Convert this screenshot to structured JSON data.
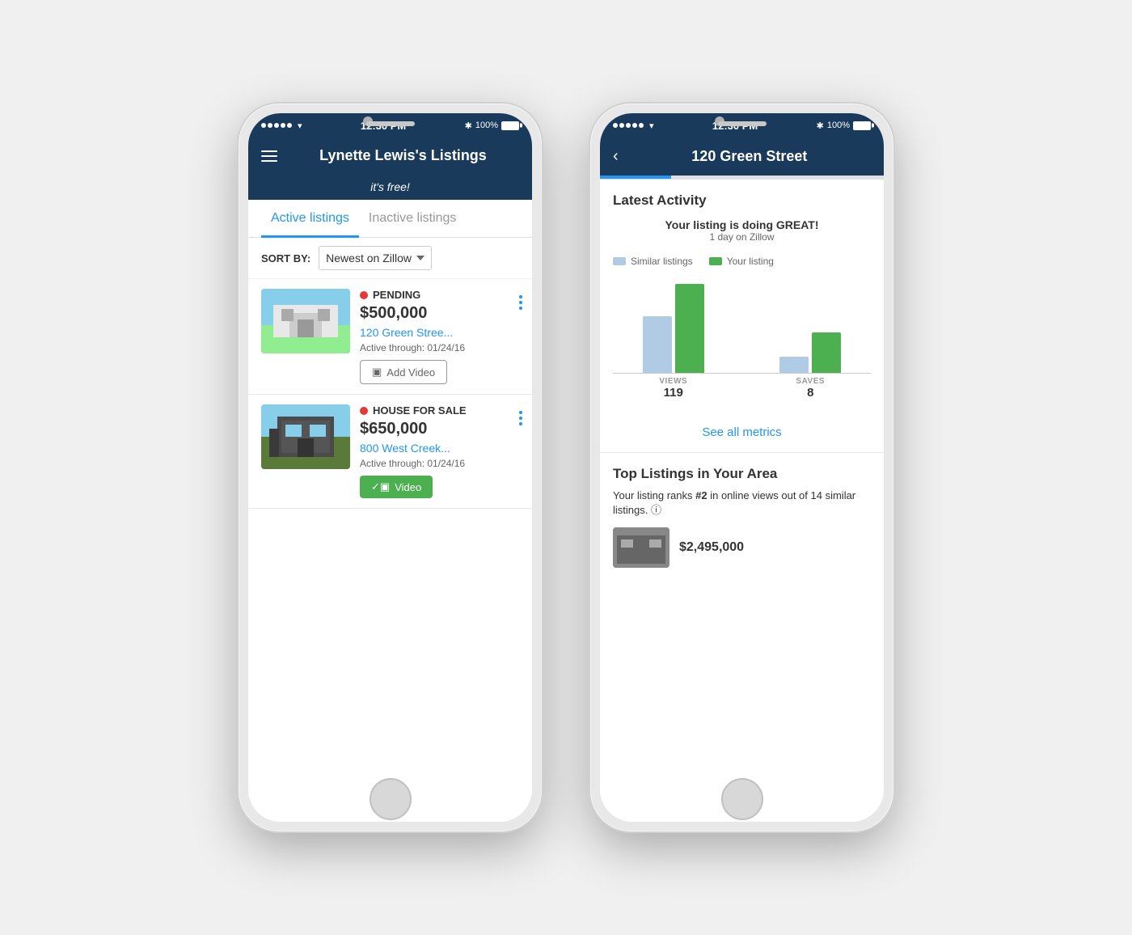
{
  "page": {
    "background": "#f0f0f0"
  },
  "phone1": {
    "status_bar": {
      "time": "12:30 PM",
      "battery": "100%",
      "bluetooth": "✱"
    },
    "header": {
      "title": "Lynette Lewis's Listings"
    },
    "promo_banner": "it's free!",
    "tabs": {
      "active": "Active listings",
      "inactive": "Inactive listings"
    },
    "sort": {
      "label": "SORT BY:",
      "selected": "Newest on Zillow"
    },
    "listings": [
      {
        "status": "PENDING",
        "price": "$500,000",
        "address": "120 Green Stree...",
        "active_through": "Active through: 01/24/16",
        "video_label": "Add Video",
        "video_type": "add"
      },
      {
        "status": "HOUSE FOR SALE",
        "price": "$650,000",
        "address": "800 West Creek...",
        "active_through": "Active through: 01/24/16",
        "video_label": "Video",
        "video_type": "has"
      }
    ]
  },
  "phone2": {
    "status_bar": {
      "time": "12:30 PM",
      "battery": "100%"
    },
    "header": {
      "title": "120 Green Street",
      "back": "‹"
    },
    "activity": {
      "title": "Latest Activity",
      "headline": "Your listing is doing GREAT!",
      "sub": "1 day on Zillow",
      "legend": {
        "similar": "Similar listings",
        "yours": "Your listing"
      },
      "chart": {
        "views": {
          "label": "VIEWS",
          "value": "119",
          "similar_height": 70,
          "yours_height": 110
        },
        "saves": {
          "label": "SAVES",
          "value": "8",
          "similar_height": 20,
          "yours_height": 50
        }
      }
    },
    "see_metrics": "See all metrics",
    "top_listings": {
      "title": "Top Listings in Your Area",
      "rank_text_prefix": "Your listing ranks ",
      "rank_bold": "#2",
      "rank_text_mid": " in online views out of 14 similar listings.",
      "preview_price": "$2,495,000"
    }
  }
}
